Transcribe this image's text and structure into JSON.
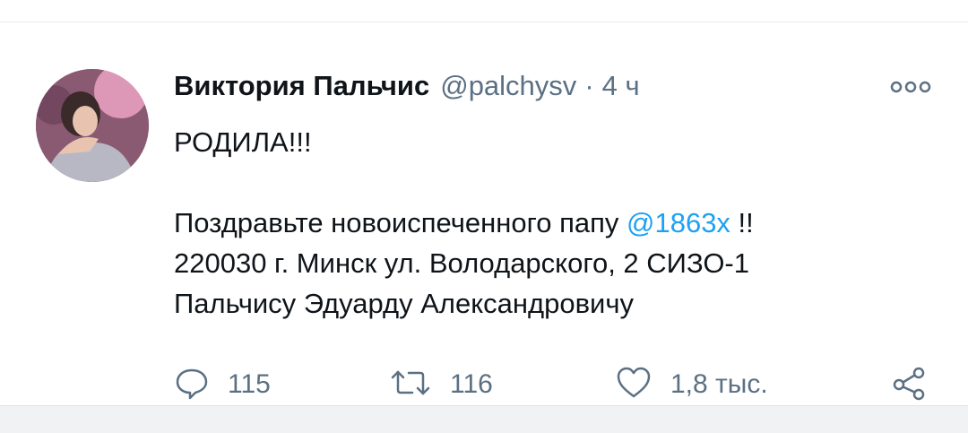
{
  "tweet": {
    "author_name": "Виктория Пальчис",
    "handle": "@palchysv",
    "separator": "·",
    "time": "4 ч",
    "line1": "РОДИЛА!!!",
    "line2_text": "Поздравьте новоиспеченного папу ",
    "line2_mention": "@1863x",
    "line2_suffix": " !!",
    "line3": "220030 г. Минск ул. Володарского, 2 СИЗО-1",
    "line4": "Пальчису Эдуарду Александровичу"
  },
  "actions": {
    "reply_count": "115",
    "retweet_count": "116",
    "like_count": "1,8 тыс."
  },
  "icons": {
    "reply": "speech-bubble-icon",
    "retweet": "retweet-icon",
    "like": "heart-icon",
    "share": "share-icon",
    "more": "more-options-icon"
  },
  "colors": {
    "mention": "#1da1f2",
    "secondary_text": "#5b7083",
    "icon": "#5b7083"
  }
}
